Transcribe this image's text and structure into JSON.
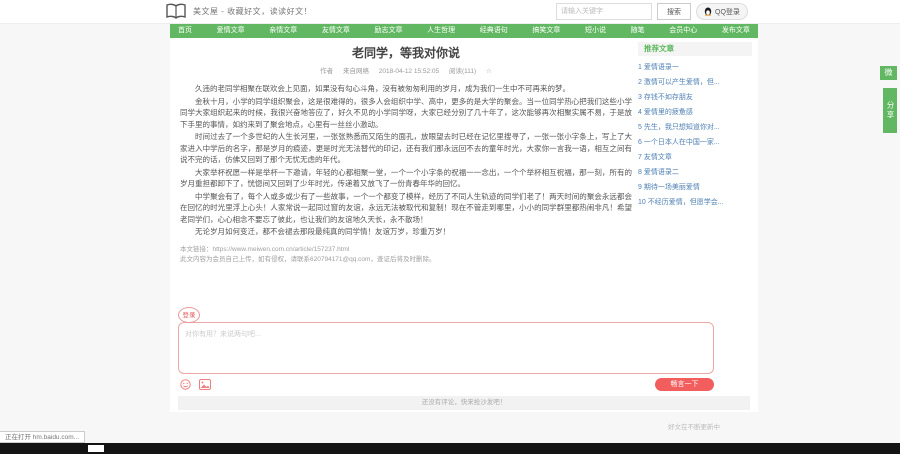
{
  "header": {
    "logo_text": "美文屋 - 收藏好文，读读好文！",
    "search_placeholder": "请输入关键字",
    "search_button": "搜索",
    "qq_login": "QQ登录"
  },
  "nav": {
    "items": [
      "首页",
      "爱情文章",
      "亲情文章",
      "友情文章",
      "励志文章",
      "人生哲理",
      "经典语句",
      "搞笑文章",
      "短小说",
      "随笔",
      "会员中心",
      "发布文章"
    ]
  },
  "article": {
    "title": "老同学，等我对你说",
    "meta": {
      "author_label": "作者",
      "source": "来自网络",
      "date": "2018-04-12 15:52:05",
      "reads": "阅读(111)",
      "star": "☆"
    },
    "paragraphs": [
      "久违的老同学相聚在联欢会上见面，如果没有勾心斗角，没有被匆匆利用的岁月，成为我们一生中不可再来的梦。",
      "金秋十月，小学的同学组织聚会，这是很难得的，很多人会组织中学、高中，更多的是大学的聚会。当一位同学热心把我们这些小学同学大家组织起来的时候，我很兴奋地答应了，好久不见的小学同学呀，大家已经分别了几十年了，这次能够再次相聚实属不易，于是放下手里的事情，如约来到了聚会地点，心里有一丝丝小激动。",
      "时间过去了一个多世纪的人生长河里，一张张熟悉而又陌生的面孔，放眼望去时已经在记忆里搜寻了，一张一张小字条上，写上了大家进入中学后的名字，那是岁月的痕迹，更是时光无法替代的印记，还有我们那永远回不去的童年时光，大家你一言我一语，相互之间有说不完的话，仿佛又回到了那个无忧无虑的年代。",
      "大家举杯祝愿一样是举杯一下邀请，年轻的心都相聚一堂，一个一个小字条的祝福一一念出，一个个举杯相互祝福，那一刻，所有的岁月重担都卸下了，恍惚间又回到了少年时光，传递着又放飞了一份青春年华的回忆。",
      "中学聚会有了，每个人或多或少有了一些故事，一个一个都变了模样，经历了不同人生轨迹的同学们老了！两天时间的聚会永远都会在回忆的时光里浮上心头！人家常说一起同过窗的友谊，永远无法被取代和复制！现在不管走到哪里，小小的同学群里都热闹非凡！希望老同学们，心心相念不要忘了彼此，也让我们的友谊地久天长，永不散场！",
      "无论岁月如何变迁，都不会褪去那段最纯真的同学情！友谊万岁，珍重万岁！"
    ],
    "link_line": "本文链接：https://www.meiwen.com.cn/article/157237.html",
    "disclaimer": "此文内容为会员自己上传，如有侵权，请联系620794171@qq.com，查证后将及时删除。"
  },
  "sidebar": {
    "title": "推荐文章",
    "items": [
      "爱情语录一",
      "激情可以产生爱情，但...",
      "存钱不如存朋友",
      "爱情里的疲惫感",
      "先生，我只想知道你对...",
      "一个日本人在中国一家...",
      "友情文章",
      "爱情语录二",
      "期待一场美丽爱情",
      "不经历爱情，但愿学会..."
    ]
  },
  "comments": {
    "login_label": "登录",
    "placeholder": "对你有用？来说两句吧...",
    "submit_button": "畅言一下",
    "empty_text": "还没有评论，快来抢沙发吧！"
  },
  "share": {
    "square_icon": "微",
    "vertical_label": "分享"
  },
  "footer": {
    "slogan": "好文在不断更新中"
  },
  "statusbar": {
    "text": "正在打开 hm.baidu.com..."
  },
  "colors": {
    "nav_green": "#62b862",
    "link_blue": "#4f80b5",
    "accent_red": "#f25d5d",
    "comment_border_pink": "#efa6a6"
  }
}
